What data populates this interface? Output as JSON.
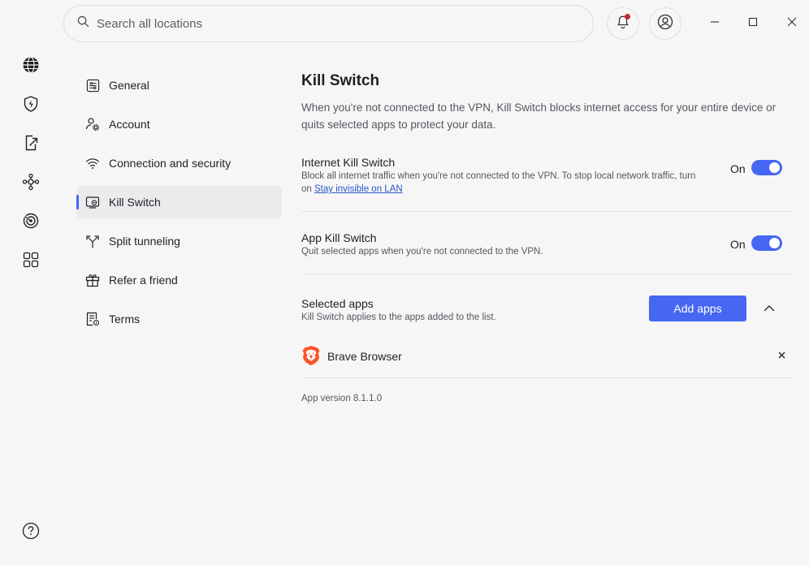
{
  "search": {
    "placeholder": "Search all locations"
  },
  "rail": {
    "items": [
      "globe-icon",
      "shield-bolt-icon",
      "share-file-icon",
      "meshnet-icon",
      "target-icon",
      "apps-grid-icon"
    ],
    "help": "help-icon"
  },
  "nav": {
    "items": [
      {
        "label": "General",
        "icon": "sliders-icon"
      },
      {
        "label": "Account",
        "icon": "user-gear-icon"
      },
      {
        "label": "Connection and security",
        "icon": "wifi-icon"
      },
      {
        "label": "Kill Switch",
        "icon": "kill-switch-icon",
        "active": true
      },
      {
        "label": "Split tunneling",
        "icon": "split-icon"
      },
      {
        "label": "Refer a friend",
        "icon": "gift-icon"
      },
      {
        "label": "Terms",
        "icon": "document-icon"
      }
    ]
  },
  "content": {
    "title": "Kill Switch",
    "intro": "When you're not connected to the VPN, Kill Switch blocks internet access for your entire device or quits selected apps to protect your data.",
    "internet": {
      "title": "Internet Kill Switch",
      "desc_prefix": "Block all internet traffic when you're not connected to the VPN. To stop local network traffic, turn on ",
      "link": "Stay invisible on LAN",
      "state": "On"
    },
    "app": {
      "title": "App Kill Switch",
      "desc": "Quit selected apps when you're not connected to the VPN.",
      "state": "On"
    },
    "selected": {
      "title": "Selected apps",
      "desc": "Kill Switch applies to the apps added to the list.",
      "add_button": "Add apps",
      "apps": [
        {
          "name": "Brave Browser",
          "icon": "brave-lion-icon"
        }
      ],
      "remove": "×"
    },
    "version": "App version 8.1.1.0"
  },
  "colors": {
    "accent": "#4667f2",
    "link": "#2a56c6",
    "notification": "#c62828"
  }
}
